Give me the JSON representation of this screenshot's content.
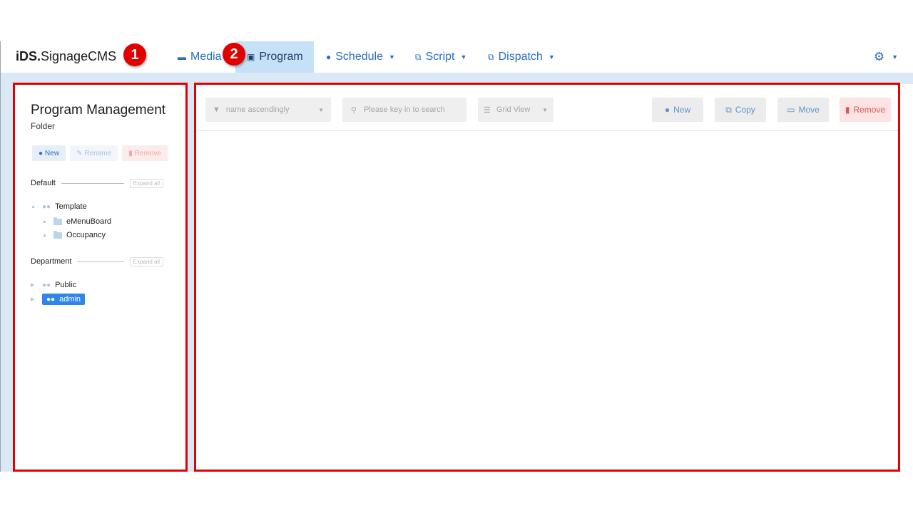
{
  "app": {
    "brand_bold": "iDS.",
    "brand_rest": "SignageCMS"
  },
  "nav": {
    "media": "Media",
    "program": "Program",
    "schedule": "Schedule",
    "script": "Script",
    "dispatch": "Dispatch",
    "active": "Program"
  },
  "left_panel": {
    "title": "Program Management",
    "subtitle": "Folder",
    "buttons": {
      "new": "New",
      "rename": "Rename",
      "remove": "Remove"
    },
    "sections": {
      "default": {
        "label": "Default",
        "expand": "Expand all"
      },
      "department": {
        "label": "Department",
        "expand": "Expand all"
      }
    },
    "tree_default": {
      "root": "Template",
      "children": [
        "eMenuBoard",
        "Occupancy"
      ]
    },
    "tree_department": {
      "items": [
        "Public",
        "admin"
      ],
      "selected": "admin"
    }
  },
  "toolbar": {
    "sort": "name ascendingly",
    "search_placeholder": "Please key in to search",
    "view": "Grid View",
    "new": "New",
    "copy": "Copy",
    "move": "Move",
    "remove": "Remove"
  },
  "annotations": {
    "badge_1": "1",
    "badge_2": "2"
  },
  "colors": {
    "accent": "#2a6fbd",
    "active_tab_bg": "#c5e1f8",
    "selected_node": "#2f86ea",
    "annotation_red": "#e20000",
    "danger": "#e25555",
    "workspace_bg": "#dbe9f6"
  },
  "icons": {
    "media": "media-icon",
    "program": "program-icon",
    "schedule": "clock-icon",
    "script": "script-icon",
    "dispatch": "dispatch-icon",
    "settings": "gear-icon",
    "filter": "filter-icon",
    "search": "search-icon",
    "grid_view": "list-icon",
    "copy": "copy-icon",
    "move": "move-icon",
    "remove": "trash-icon",
    "folder": "folder-icon",
    "users": "users-icon"
  }
}
